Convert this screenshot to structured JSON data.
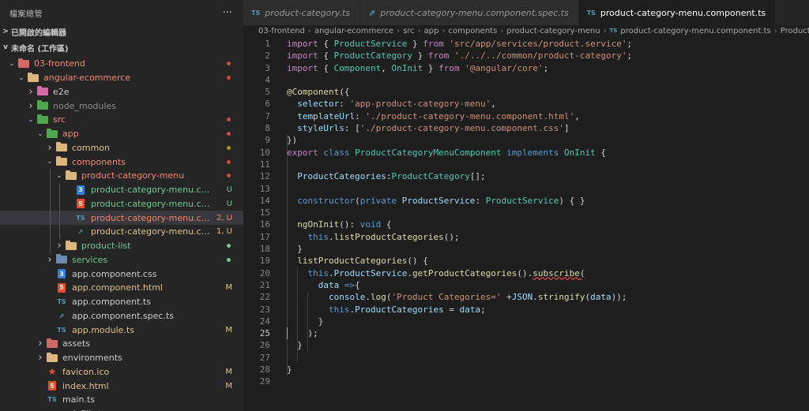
{
  "explorer": {
    "title": "檔案總管",
    "more": "···",
    "open_editors": "已開啟的編輯器",
    "workspace": "未命名 (工作區)"
  },
  "tree": [
    {
      "label": "03-frontend",
      "depth": 0,
      "chev": "v",
      "icon": "folder",
      "ic": "f-red",
      "color": "c-err",
      "mark": "dot",
      "markc": "#c74e39"
    },
    {
      "label": "angular-ecommerce",
      "depth": 1,
      "chev": "v",
      "icon": "folder",
      "ic": "f-yel",
      "color": "c-err",
      "mark": "dot",
      "markc": "#c74e39"
    },
    {
      "label": "e2e",
      "depth": 2,
      "chev": ">",
      "icon": "folder",
      "ic": "f-pnk",
      "color": "c-def",
      "mark": "",
      "markc": ""
    },
    {
      "label": "node_modules",
      "depth": 2,
      "chev": ">",
      "icon": "folder",
      "ic": "f-grn",
      "color": "c-gray",
      "mark": "",
      "markc": ""
    },
    {
      "label": "src",
      "depth": 2,
      "chev": "v",
      "icon": "folder",
      "ic": "f-grn",
      "color": "c-err",
      "mark": "dot",
      "markc": "#c74e39"
    },
    {
      "label": "app",
      "depth": 3,
      "chev": "v",
      "icon": "folder",
      "ic": "f-grn",
      "color": "c-err",
      "mark": "dot",
      "markc": "#c74e39"
    },
    {
      "label": "common",
      "depth": 4,
      "chev": ">",
      "icon": "folder",
      "ic": "f-yel",
      "color": "c-mod",
      "mark": "dot",
      "markc": "#b89500"
    },
    {
      "label": "components",
      "depth": 4,
      "chev": "v",
      "icon": "folder",
      "ic": "f-yel",
      "color": "c-err",
      "mark": "dot",
      "markc": "#c74e39"
    },
    {
      "label": "product-category-menu",
      "depth": 5,
      "chev": "v",
      "icon": "folder",
      "ic": "f-yel",
      "color": "c-err",
      "mark": "dot",
      "markc": "#c74e39"
    },
    {
      "label": "product-category-menu.component.css",
      "depth": 6,
      "chev": "",
      "icon": "css",
      "ic": "",
      "color": "c-unt",
      "mark": "U",
      "markc": "#73c991"
    },
    {
      "label": "product-category-menu.component.html",
      "depth": 6,
      "chev": "",
      "icon": "html",
      "ic": "",
      "color": "c-unt",
      "mark": "U",
      "markc": "#73c991"
    },
    {
      "label": "product-category-menu.component.ts",
      "depth": 6,
      "chev": "",
      "icon": "ts",
      "ic": "",
      "color": "c-err",
      "mark": "2, U",
      "markc": "#f48771",
      "selected": true
    },
    {
      "label": "product-category-menu.component.spec.ts",
      "depth": 6,
      "chev": "",
      "icon": "spec",
      "ic": "",
      "color": "c-mod",
      "mark": "1, U",
      "markc": "#e2c08d"
    },
    {
      "label": "product-list",
      "depth": 5,
      "chev": ">",
      "icon": "folder",
      "ic": "f-yel",
      "color": "c-unt",
      "mark": "dot",
      "markc": "#73c991"
    },
    {
      "label": "services",
      "depth": 4,
      "chev": ">",
      "icon": "folder",
      "ic": "f-gry",
      "color": "c-unt",
      "mark": "dot",
      "markc": "#73c991"
    },
    {
      "label": "app.component.css",
      "depth": 4,
      "chev": "",
      "icon": "css",
      "ic": "",
      "color": "c-def",
      "mark": "",
      "markc": ""
    },
    {
      "label": "app.component.html",
      "depth": 4,
      "chev": "",
      "icon": "html",
      "ic": "",
      "color": "c-mod",
      "mark": "M",
      "markc": "#e2c08d"
    },
    {
      "label": "app.component.ts",
      "depth": 4,
      "chev": "",
      "icon": "ts",
      "ic": "",
      "color": "c-def",
      "mark": "",
      "markc": ""
    },
    {
      "label": "app.component.spec.ts",
      "depth": 4,
      "chev": "",
      "icon": "spec",
      "ic": "",
      "color": "c-def",
      "mark": "",
      "markc": ""
    },
    {
      "label": "app.module.ts",
      "depth": 4,
      "chev": "",
      "icon": "ts",
      "ic": "",
      "color": "c-mod",
      "mark": "M",
      "markc": "#e2c08d"
    },
    {
      "label": "assets",
      "depth": 3,
      "chev": ">",
      "icon": "folder",
      "ic": "f-red",
      "color": "c-def",
      "mark": "",
      "markc": ""
    },
    {
      "label": "environments",
      "depth": 3,
      "chev": ">",
      "icon": "folder",
      "ic": "f-yel",
      "color": "c-def",
      "mark": "",
      "markc": ""
    },
    {
      "label": "favicon.ico",
      "depth": 3,
      "chev": "",
      "icon": "star",
      "ic": "",
      "color": "c-mod",
      "mark": "M",
      "markc": "#e2c08d"
    },
    {
      "label": "index.html",
      "depth": 3,
      "chev": "",
      "icon": "html",
      "ic": "",
      "color": "c-mod",
      "mark": "M",
      "markc": "#e2c08d"
    },
    {
      "label": "main.ts",
      "depth": 3,
      "chev": "",
      "icon": "ts",
      "ic": "",
      "color": "c-def",
      "mark": "",
      "markc": ""
    },
    {
      "label": "polyfills.ts",
      "depth": 3,
      "chev": "",
      "icon": "ts",
      "ic": "",
      "color": "c-def",
      "mark": "",
      "markc": ""
    }
  ],
  "tabs": [
    {
      "label": "product-category.ts",
      "icon": "TS",
      "active": false
    },
    {
      "label": "product-category-menu.component.spec.ts",
      "icon": "spec",
      "active": false
    },
    {
      "label": "product-category-menu.component.ts",
      "icon": "TS",
      "active": true
    }
  ],
  "breadcrumb": [
    "03-frontend",
    "angular-ecommerce",
    "src",
    "app",
    "components",
    "product-category-menu",
    "product-category-menu.component.ts",
    "Product"
  ],
  "icon_text": {
    "ts": "TS",
    "css": "3",
    "html": "5",
    "spec": "⇗",
    "star": "★"
  },
  "code": [
    [
      [
        "kw",
        "import"
      ],
      [
        "pu",
        " { "
      ],
      [
        "ty",
        "ProductService"
      ],
      [
        "pu",
        " } "
      ],
      [
        "kw",
        "from"
      ],
      [
        "pu",
        " "
      ],
      [
        "st",
        "'src/app/services/product.service'"
      ],
      [
        "pu",
        ";"
      ]
    ],
    [
      [
        "kw",
        "import"
      ],
      [
        "pu",
        " { "
      ],
      [
        "ty",
        "ProductCategory"
      ],
      [
        "pu",
        " } "
      ],
      [
        "kw",
        "from"
      ],
      [
        "pu",
        " "
      ],
      [
        "st",
        "'./../../common/product-category'"
      ],
      [
        "pu",
        ";"
      ]
    ],
    [
      [
        "kw",
        "import"
      ],
      [
        "pu",
        " { "
      ],
      [
        "ty",
        "Component"
      ],
      [
        "pu",
        ", "
      ],
      [
        "ty",
        "OnInit"
      ],
      [
        "pu",
        " } "
      ],
      [
        "kw",
        "from"
      ],
      [
        "pu",
        " "
      ],
      [
        "st",
        "'@angular/core'"
      ],
      [
        "pu",
        ";"
      ]
    ],
    [],
    [
      [
        "fn",
        "@Component"
      ],
      [
        "pu",
        "({"
      ]
    ],
    [
      [
        "pu",
        "  "
      ],
      [
        "va",
        "selector"
      ],
      [
        "pu",
        ": "
      ],
      [
        "st",
        "'app-product-category-menu'"
      ],
      [
        "pu",
        ","
      ]
    ],
    [
      [
        "pu",
        "  "
      ],
      [
        "va",
        "templateUrl"
      ],
      [
        "pu",
        ": "
      ],
      [
        "st",
        "'./product-category-menu.component.html'"
      ],
      [
        "pu",
        ","
      ]
    ],
    [
      [
        "pu",
        "  "
      ],
      [
        "va",
        "styleUrls"
      ],
      [
        "pu",
        ": ["
      ],
      [
        "st",
        "'./product-category-menu.component.css'"
      ],
      [
        "pu",
        "]"
      ]
    ],
    [
      [
        "pu",
        "})"
      ]
    ],
    [
      [
        "kw",
        "export"
      ],
      [
        "pu",
        " "
      ],
      [
        "bk",
        "class"
      ],
      [
        "pu",
        " "
      ],
      [
        "ty",
        "ProductCategoryMenuComponent"
      ],
      [
        "pu",
        " "
      ],
      [
        "bk",
        "implements"
      ],
      [
        "pu",
        " "
      ],
      [
        "ty",
        "OnInit"
      ],
      [
        "pu",
        " {"
      ]
    ],
    [],
    [
      [
        "pu",
        "  "
      ],
      [
        "va",
        "ProductCategories"
      ],
      [
        "pu",
        ":"
      ],
      [
        "ty",
        "ProductCategory"
      ],
      [
        "pu",
        "[];"
      ]
    ],
    [],
    [
      [
        "pu",
        "  "
      ],
      [
        "bk",
        "constructor"
      ],
      [
        "pu",
        "("
      ],
      [
        "bk",
        "private"
      ],
      [
        "pu",
        " "
      ],
      [
        "va",
        "ProductService"
      ],
      [
        "pu",
        ": "
      ],
      [
        "ty",
        "ProductService"
      ],
      [
        "pu",
        ") { }"
      ]
    ],
    [],
    [
      [
        "pu",
        "  "
      ],
      [
        "fn",
        "ngOnInit"
      ],
      [
        "pu",
        "(): "
      ],
      [
        "bk",
        "void"
      ],
      [
        "pu",
        " {"
      ]
    ],
    [
      [
        "pu",
        "    "
      ],
      [
        "bk",
        "this"
      ],
      [
        "pu",
        "."
      ],
      [
        "fn",
        "listProductCategories"
      ],
      [
        "pu",
        "();"
      ]
    ],
    [
      [
        "pu",
        "  }"
      ]
    ],
    [
      [
        "pu",
        "  "
      ],
      [
        "fn",
        "listProductCategories"
      ],
      [
        "pu",
        "() {"
      ]
    ],
    [
      [
        "pu",
        "    "
      ],
      [
        "bk",
        "this"
      ],
      [
        "pu",
        "."
      ],
      [
        "va",
        "ProductService"
      ],
      [
        "pu",
        "."
      ],
      [
        "fn",
        "getProductCategories"
      ],
      [
        "pu",
        "()."
      ],
      [
        "fn",
        "subscribe",
        "squig"
      ],
      [
        "pu",
        "(",
        "squig"
      ]
    ],
    [
      [
        "pu",
        "      "
      ],
      [
        "va",
        "data"
      ],
      [
        "pu",
        " "
      ],
      [
        "bk",
        "=>"
      ],
      [
        "pu",
        "{"
      ]
    ],
    [
      [
        "pu",
        "        "
      ],
      [
        "va",
        "console"
      ],
      [
        "pu",
        "."
      ],
      [
        "fn",
        "log"
      ],
      [
        "pu",
        "("
      ],
      [
        "st",
        "'Product Categories='"
      ],
      [
        "pu",
        " +"
      ],
      [
        "va",
        "JSON"
      ],
      [
        "pu",
        "."
      ],
      [
        "fn",
        "stringify"
      ],
      [
        "pu",
        "("
      ],
      [
        "va",
        "data"
      ],
      [
        "pu",
        "));"
      ]
    ],
    [
      [
        "pu",
        "        "
      ],
      [
        "bk",
        "this"
      ],
      [
        "pu",
        "."
      ],
      [
        "va",
        "ProductCategories"
      ],
      [
        "pu",
        " = "
      ],
      [
        "va",
        "data"
      ],
      [
        "pu",
        ";"
      ]
    ],
    [
      [
        "pu",
        "      }"
      ]
    ],
    [
      [
        "pu",
        "    );"
      ]
    ],
    [
      [
        "pu",
        "  }"
      ]
    ],
    [],
    [
      [
        "pu",
        "}"
      ]
    ],
    []
  ],
  "current_line": 25,
  "colors": {
    "selected_file": "#f48771",
    "accent": "#007acc"
  }
}
